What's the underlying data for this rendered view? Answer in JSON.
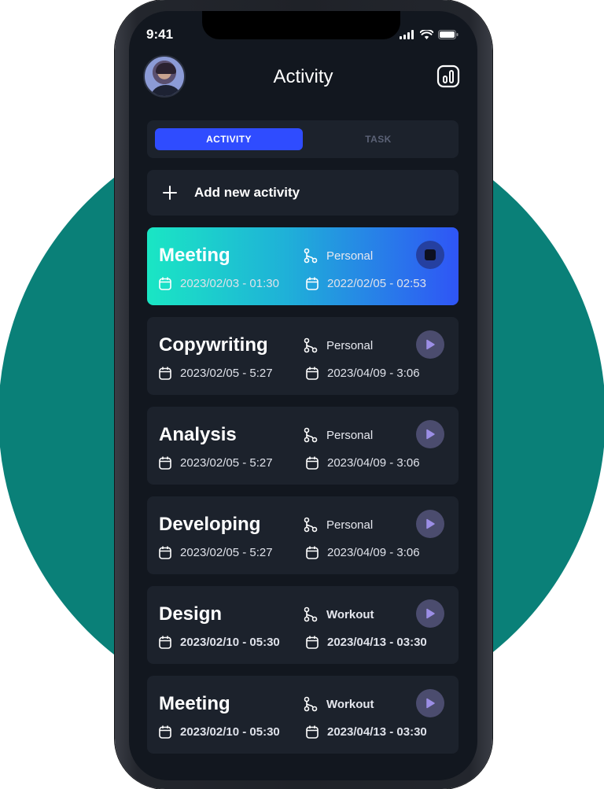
{
  "status": {
    "time": "9:41"
  },
  "header": {
    "title": "Activity"
  },
  "tabs": [
    {
      "label": "ACTIVITY",
      "active": true
    },
    {
      "label": "TASK",
      "active": false
    }
  ],
  "add": {
    "label": "Add new activity"
  },
  "activities": [
    {
      "title": "Meeting",
      "category": "Personal",
      "start": "2023/02/03 - 01:30",
      "end": "2022/02/05 - 02:53",
      "state": "running"
    },
    {
      "title": "Copywriting",
      "category": "Personal",
      "start": "2023/02/05 - 5:27",
      "end": "2023/04/09 - 3:06",
      "state": "paused"
    },
    {
      "title": "Analysis",
      "category": "Personal",
      "start": "2023/02/05 - 5:27",
      "end": "2023/04/09 - 3:06",
      "state": "paused"
    },
    {
      "title": "Developing",
      "category": "Personal",
      "start": "2023/02/05 - 5:27",
      "end": "2023/04/09 - 3:06",
      "state": "paused"
    },
    {
      "title": "Design",
      "category": "Workout",
      "start": "2023/02/10 - 05:30",
      "end": "2023/04/13 - 03:30",
      "state": "paused"
    },
    {
      "title": "Meeting",
      "category": "Workout",
      "start": "2023/02/10 - 05:30",
      "end": "2023/04/13 - 03:30",
      "state": "paused"
    }
  ],
  "icons": {
    "category": "branch-icon",
    "date": "calendar-icon",
    "play": "play-icon",
    "stop": "stop-icon",
    "stats": "bar-chart-icon",
    "add": "plus-icon"
  },
  "colors": {
    "background_circle": "#0a8078",
    "screen": "#12171f",
    "card": "#1c222c",
    "accent": "#2f4cff",
    "active_gradient_start": "#1ae6c4",
    "active_gradient_end": "#2f55f6",
    "play_button": "#4b4c6e"
  }
}
